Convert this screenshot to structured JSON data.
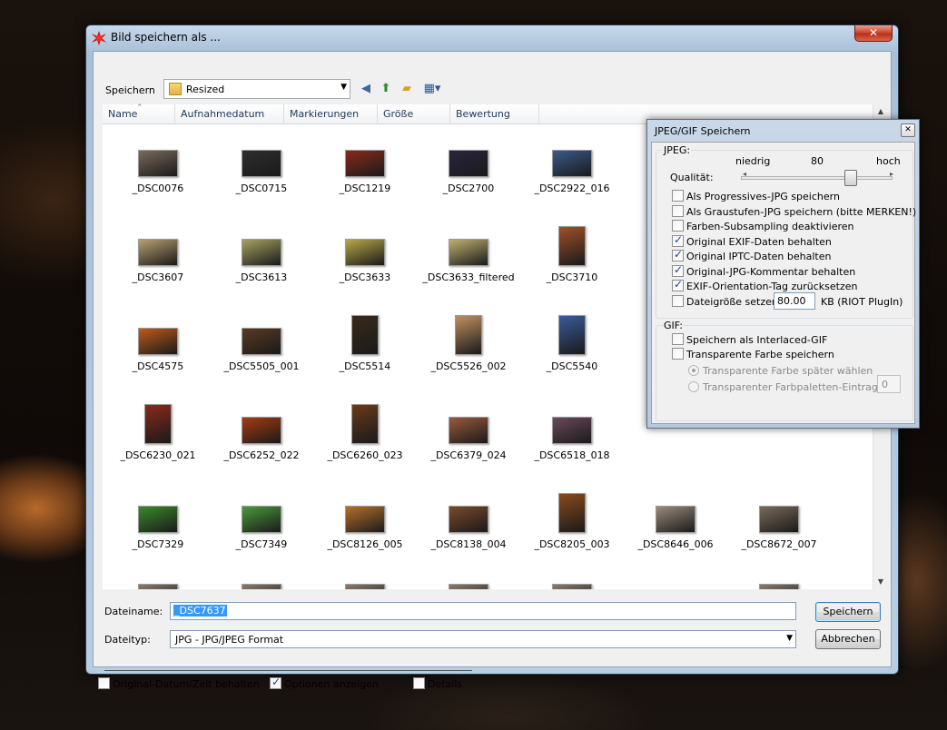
{
  "window": {
    "title": "Bild speichern als ..."
  },
  "toolbar": {
    "save_in_label": "Speichern",
    "folder": "Resized",
    "icons": [
      "back-icon",
      "up-folder-icon",
      "new-folder-icon",
      "view-menu-icon"
    ]
  },
  "columns": [
    "Name",
    "Aufnahmedatum",
    "Markierungen",
    "Größe",
    "Bewertung"
  ],
  "thumbnails": [
    {
      "label": "_DSC0076",
      "color": "#7a6a5a"
    },
    {
      "label": "_DSC0715",
      "color": "#2e2e2e"
    },
    {
      "label": "_DSC1219",
      "color": "#8a2a1a"
    },
    {
      "label": "_DSC2700",
      "color": "#2a2440"
    },
    {
      "label": "_DSC2922_016",
      "color": "#3a5a8a"
    },
    {
      "label": "",
      "color": "#6a88a8"
    },
    {
      "label": "",
      "color": "#8a7a5a"
    },
    {
      "label": "_DSC3607",
      "color": "#b8a070"
    },
    {
      "label": "_DSC3613",
      "color": "#a8a060"
    },
    {
      "label": "_DSC3633",
      "color": "#b8a848"
    },
    {
      "label": "_DSC3633_filtered",
      "color": "#c0b070"
    },
    {
      "label": "_DSC3710",
      "color": "#a0502a"
    },
    {
      "label": "_DSC4575",
      "color": "#c05a1a"
    },
    {
      "label": "_DSC5505_001",
      "color": "#5a3a20"
    },
    {
      "label": "_DSC5514",
      "color": "#3a2a1a"
    },
    {
      "label": "_DSC5526_002",
      "color": "#c09060"
    },
    {
      "label": "_DSC5540",
      "color": "#3a5a9a"
    },
    {
      "label": "_DSC6230_021",
      "color": "#8a2a1a"
    },
    {
      "label": "_DSC6252_022",
      "color": "#a83a10"
    },
    {
      "label": "_DSC6260_023",
      "color": "#6a3a1a"
    },
    {
      "label": "_DSC6379_024",
      "color": "#9a5a3a"
    },
    {
      "label": "_DSC6518_018",
      "color": "#6a4a5a"
    },
    {
      "label": "_DSC7329",
      "color": "#3a8a2a"
    },
    {
      "label": "_DSC7349",
      "color": "#4a9a3a"
    },
    {
      "label": "_DSC8126_005",
      "color": "#b8702a"
    },
    {
      "label": "_DSC8138_004",
      "color": "#7a4a2a"
    },
    {
      "label": "_DSC8205_003",
      "color": "#8a4a1a"
    },
    {
      "label": "_DSC8646_006",
      "color": "#9a8a7a"
    },
    {
      "label": "_DSC8672_007",
      "color": "#7a6a5a"
    }
  ],
  "filename": {
    "label": "Dateiname:",
    "value": "_DSC7637"
  },
  "filetype": {
    "label": "Dateityp:",
    "value": "JPG - JPG/JPEG Format"
  },
  "buttons": {
    "save": "Speichern",
    "cancel": "Abbrechen"
  },
  "footer": {
    "keep_date": {
      "label": "Original-Datum/Zeit behalten",
      "checked": false
    },
    "show_options": {
      "label": "Optionen anzeigen",
      "checked": true
    },
    "details": {
      "label": "Details",
      "checked": false
    }
  },
  "options_dialog": {
    "title": "JPEG/GIF Speichern",
    "jpeg_group": "JPEG:",
    "quality_low": "niedrig",
    "quality_value": "80",
    "quality_high": "hoch",
    "quality_label": "Qualität:",
    "jpeg_checks": [
      {
        "label": "Als Progressives-JPG speichern",
        "checked": false
      },
      {
        "label": "Als Graustufen-JPG speichern (bitte MERKEN!)",
        "checked": false
      },
      {
        "label": "Farben-Subsampling deaktivieren",
        "checked": false
      },
      {
        "label": "Original EXIF-Daten behalten",
        "checked": true
      },
      {
        "label": "Original IPTC-Daten behalten",
        "checked": true
      },
      {
        "label": "Original-JPG-Kommentar behalten",
        "checked": true
      },
      {
        "label": "EXIF-Orientation-Tag zurücksetzen",
        "checked": true
      }
    ],
    "filesize_label": "Dateigröße setzen:",
    "filesize_value": "80.00",
    "filesize_unit": "KB (RIOT PlugIn)",
    "gif_group": "GIF:",
    "gif_checks": [
      {
        "label": "Speichern als Interlaced-GIF",
        "checked": false
      },
      {
        "label": "Transparente Farbe speichern",
        "checked": false
      }
    ],
    "radio_later": "Transparente Farbe später wählen",
    "radio_palette": "Transparenter Farbpaletten-Eintrag:",
    "palette_value": "0"
  }
}
